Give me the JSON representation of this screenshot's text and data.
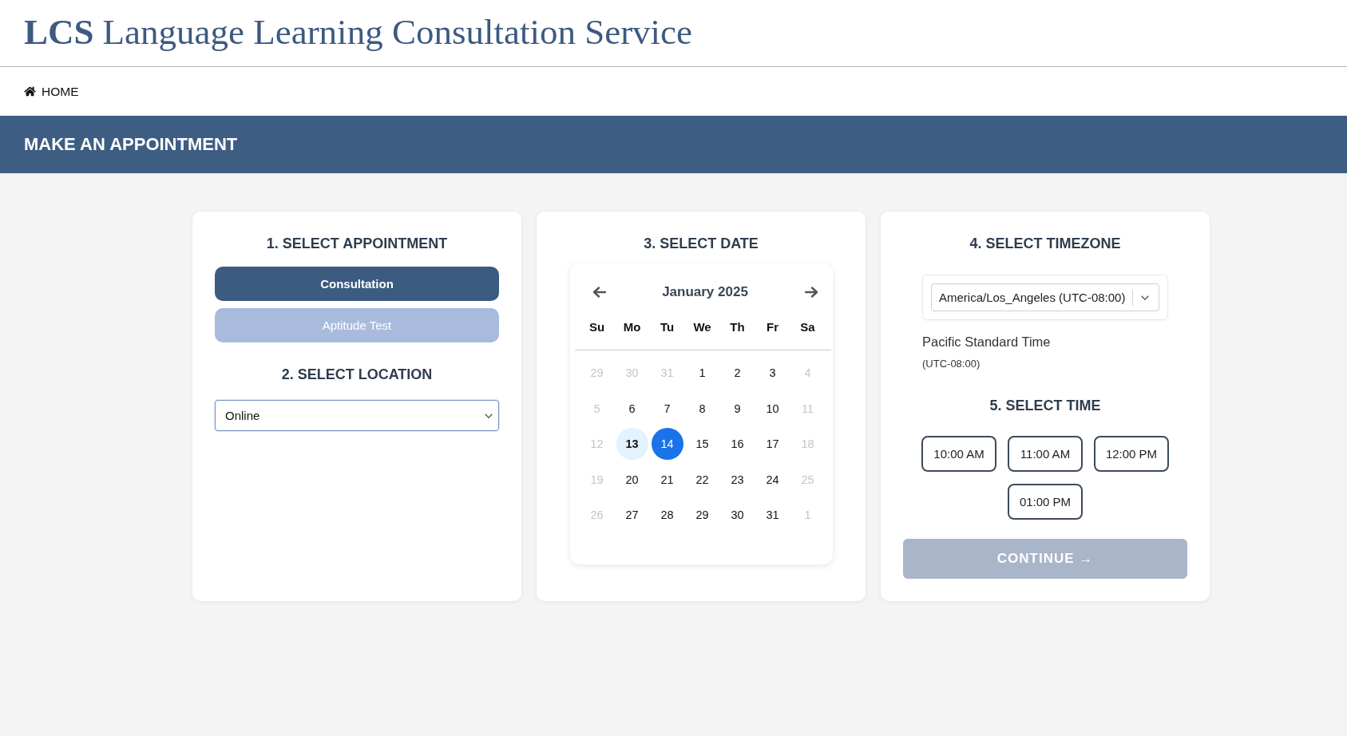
{
  "header": {
    "logo": "LCS",
    "title": "Language Learning Consultation Service"
  },
  "nav": {
    "home_link": "HOME"
  },
  "banner": {
    "title": "MAKE AN APPOINTMENT"
  },
  "appointment": {
    "heading": "1. SELECT APPOINTMENT",
    "options": [
      {
        "label": "Consultation",
        "selected": true
      },
      {
        "label": "Aptitude Test",
        "selected": false
      }
    ]
  },
  "location": {
    "heading": "2. SELECT LOCATION",
    "value": "Online"
  },
  "date": {
    "heading": "3. SELECT DATE",
    "month": "January 2025",
    "weekdays": [
      "Su",
      "Mo",
      "Tu",
      "We",
      "Th",
      "Fr",
      "Sa"
    ],
    "weeks": [
      [
        {
          "day": "29",
          "outside": true,
          "today": false,
          "selected": false
        },
        {
          "day": "30",
          "outside": true,
          "today": false,
          "selected": false
        },
        {
          "day": "31",
          "outside": true,
          "today": false,
          "selected": false
        },
        {
          "day": "1",
          "outside": false,
          "today": false,
          "selected": false
        },
        {
          "day": "2",
          "outside": false,
          "today": false,
          "selected": false
        },
        {
          "day": "3",
          "outside": false,
          "today": false,
          "selected": false
        },
        {
          "day": "4",
          "outside": true,
          "today": false,
          "selected": false
        }
      ],
      [
        {
          "day": "5",
          "outside": true,
          "today": false,
          "selected": false
        },
        {
          "day": "6",
          "outside": false,
          "today": false,
          "selected": false
        },
        {
          "day": "7",
          "outside": false,
          "today": false,
          "selected": false
        },
        {
          "day": "8",
          "outside": false,
          "today": false,
          "selected": false
        },
        {
          "day": "9",
          "outside": false,
          "today": false,
          "selected": false
        },
        {
          "day": "10",
          "outside": false,
          "today": false,
          "selected": false
        },
        {
          "day": "11",
          "outside": true,
          "today": false,
          "selected": false
        }
      ],
      [
        {
          "day": "12",
          "outside": true,
          "today": false,
          "selected": false
        },
        {
          "day": "13",
          "outside": false,
          "today": true,
          "selected": false
        },
        {
          "day": "14",
          "outside": false,
          "today": false,
          "selected": true
        },
        {
          "day": "15",
          "outside": false,
          "today": false,
          "selected": false
        },
        {
          "day": "16",
          "outside": false,
          "today": false,
          "selected": false
        },
        {
          "day": "17",
          "outside": false,
          "today": false,
          "selected": false
        },
        {
          "day": "18",
          "outside": true,
          "today": false,
          "selected": false
        }
      ],
      [
        {
          "day": "19",
          "outside": true,
          "today": false,
          "selected": false
        },
        {
          "day": "20",
          "outside": false,
          "today": false,
          "selected": false
        },
        {
          "day": "21",
          "outside": false,
          "today": false,
          "selected": false
        },
        {
          "day": "22",
          "outside": false,
          "today": false,
          "selected": false
        },
        {
          "day": "23",
          "outside": false,
          "today": false,
          "selected": false
        },
        {
          "day": "24",
          "outside": false,
          "today": false,
          "selected": false
        },
        {
          "day": "25",
          "outside": true,
          "today": false,
          "selected": false
        }
      ],
      [
        {
          "day": "26",
          "outside": true,
          "today": false,
          "selected": false
        },
        {
          "day": "27",
          "outside": false,
          "today": false,
          "selected": false
        },
        {
          "day": "28",
          "outside": false,
          "today": false,
          "selected": false
        },
        {
          "day": "29",
          "outside": false,
          "today": false,
          "selected": false
        },
        {
          "day": "30",
          "outside": false,
          "today": false,
          "selected": false
        },
        {
          "day": "31",
          "outside": false,
          "today": false,
          "selected": false
        },
        {
          "day": "1",
          "outside": true,
          "today": false,
          "selected": false
        }
      ]
    ]
  },
  "timezone": {
    "heading": "4. SELECT TIMEZONE",
    "value": "America/Los_Angeles (UTC-08:00)",
    "name": "Pacific Standard Time",
    "offset": "(UTC-08:00)"
  },
  "time": {
    "heading": "5. SELECT TIME",
    "slots": [
      {
        "label": "10:00 AM",
        "selected": false
      },
      {
        "label": "11:00 AM",
        "selected": false
      },
      {
        "label": "12:00 PM",
        "selected": false
      },
      {
        "label": "01:00 PM",
        "selected": false
      }
    ]
  },
  "continue_button": {
    "label": "CONTINUE →",
    "disabled": true
  }
}
